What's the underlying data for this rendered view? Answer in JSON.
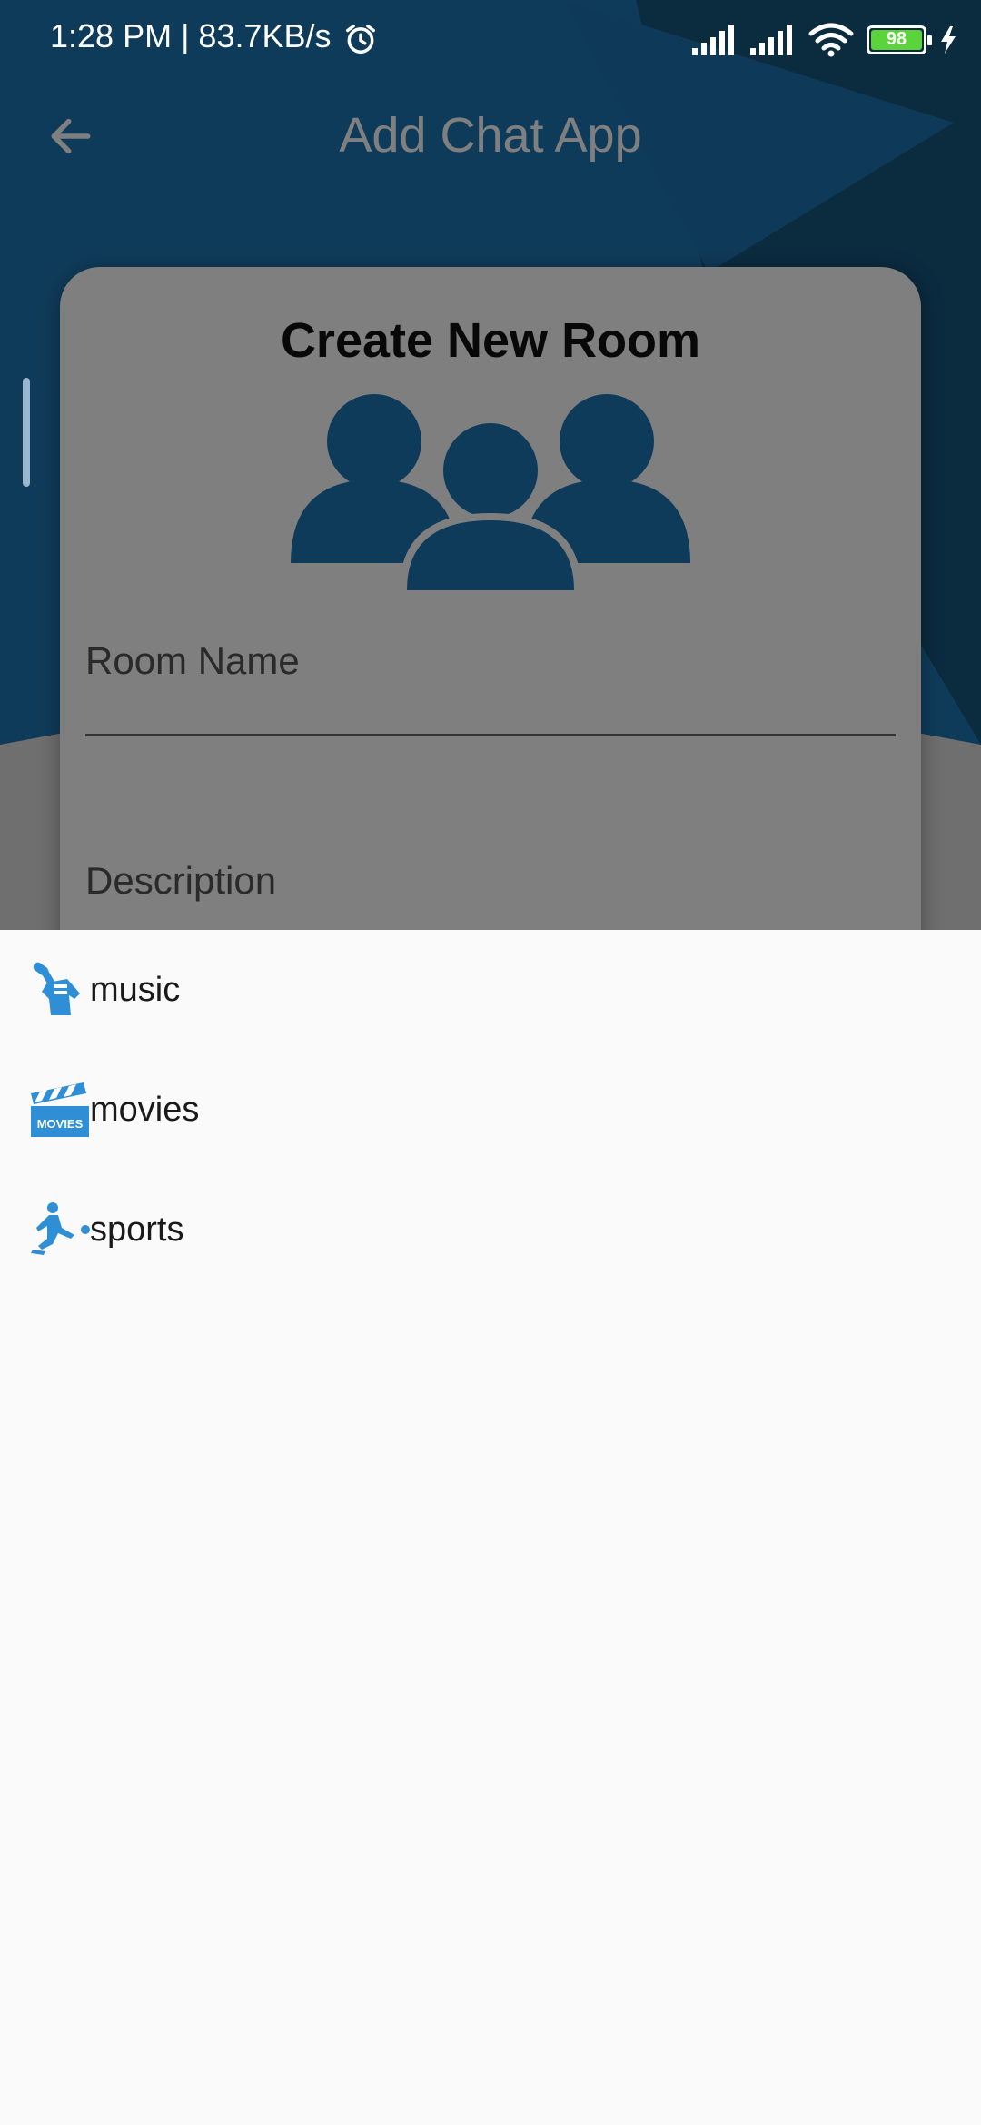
{
  "status_bar": {
    "time_speed": "1:28 PM | 83.7KB/s",
    "battery": "98"
  },
  "app_bar": {
    "title": "Add Chat App"
  },
  "card": {
    "heading": "Create New Room",
    "room_name_label": "Room Name",
    "description_label": "Description"
  },
  "sheet": {
    "options": [
      {
        "label": "music",
        "icon": "microphone-fist-icon"
      },
      {
        "label": "movies",
        "icon": "clapperboard-icon"
      },
      {
        "label": "sports",
        "icon": "soccer-player-icon"
      }
    ]
  },
  "colors": {
    "primary": "#1f77b4",
    "icon_blue": "#2f8fd6",
    "sheet_bg": "#fafafa"
  }
}
